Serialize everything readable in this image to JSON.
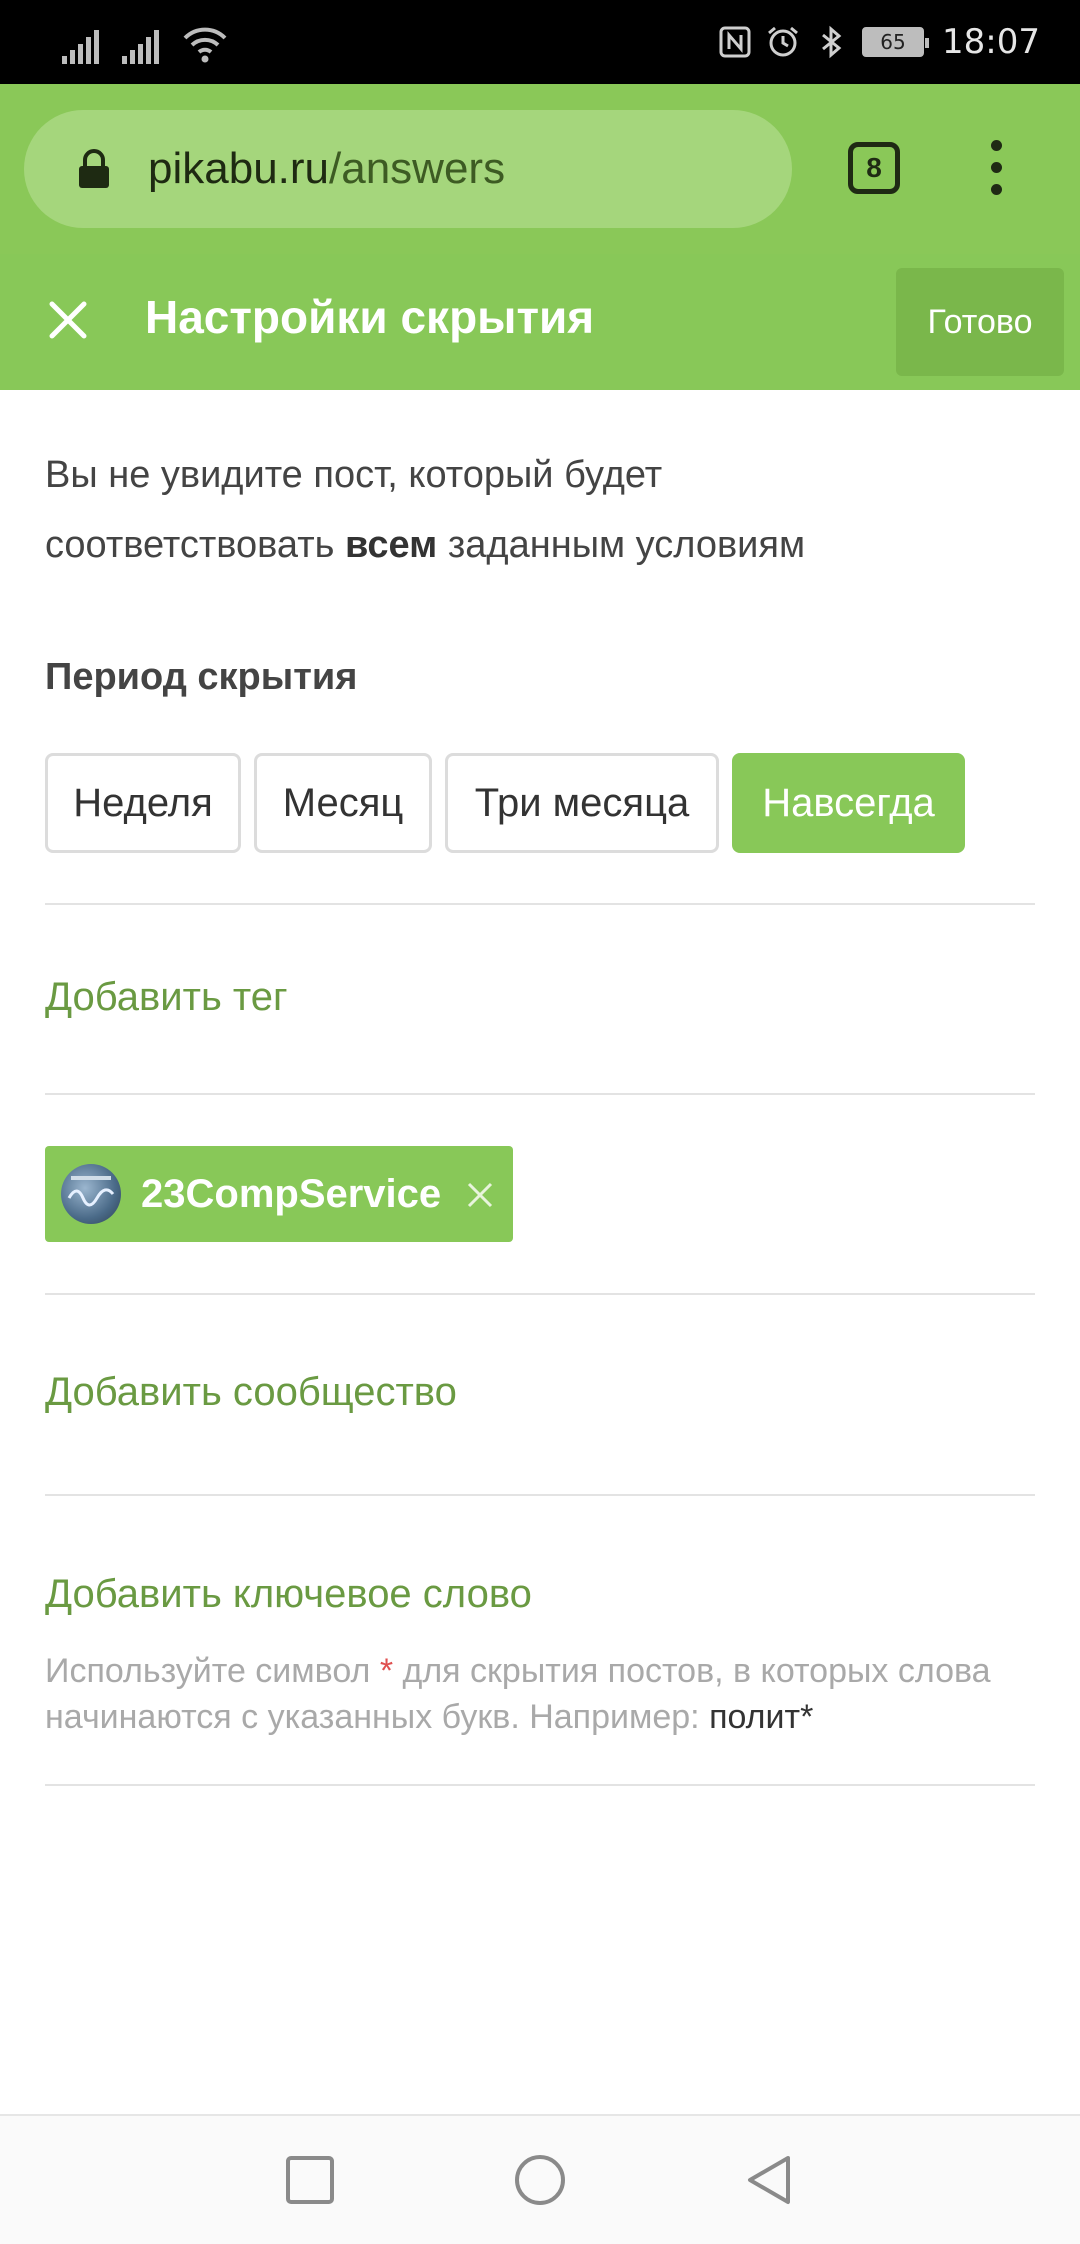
{
  "status_bar": {
    "time": "18:07",
    "battery": "65",
    "icons": [
      "signal-icon",
      "signal-icon",
      "wifi-icon",
      "nfc-icon",
      "alarm-icon",
      "bluetooth-icon",
      "battery-icon"
    ]
  },
  "browser": {
    "url_host": "pikabu.ru",
    "url_path": "/answers",
    "tabs_count": "8",
    "accent_color": "#8ac858"
  },
  "header": {
    "title": "Настройки скрытия",
    "done_label": "Готово"
  },
  "description": {
    "line1": "Вы не увидите пост, который будет",
    "line2_before": "соответствовать ",
    "line2_bold": "всем",
    "line2_after": " заданным условиям"
  },
  "period": {
    "title": "Период скрытия",
    "options": [
      "Неделя",
      "Месяц",
      "Три месяца",
      "Навсегда"
    ],
    "selected": "Навсегда"
  },
  "add_tag_label": "Добавить тег",
  "tag": {
    "name": "23CompService"
  },
  "add_community_label": "Добавить сообщество",
  "add_keyword_label": "Добавить ключевое слово",
  "hint": {
    "before_star": "Используйте символ ",
    "star": "*",
    "after_star": " для скрытия постов, в которых слова начинаются с указанных букв. Например: ",
    "example": "полит*"
  }
}
